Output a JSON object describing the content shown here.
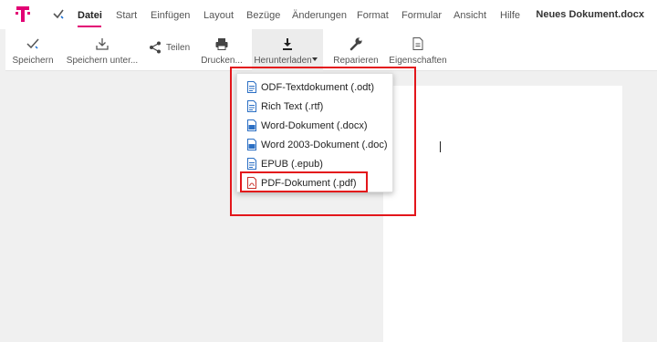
{
  "app": {
    "logo": "telekom-t-logo",
    "document_title": "Neues Dokument.docx",
    "brand_color": "#e20074"
  },
  "menu": {
    "check_icon": "check-icon",
    "items": [
      "Datei",
      "Start",
      "Einfügen",
      "Layout",
      "Bezüge",
      "Änderungen",
      "Format",
      "Formular",
      "Ansicht",
      "Hilfe"
    ],
    "active": "Datei"
  },
  "ribbon": {
    "save": "Speichern",
    "save_as": "Speichern unter...",
    "share": "Teilen",
    "print": "Drucken...",
    "download": "Herunterladen",
    "repair": "Reparieren",
    "properties": "Eigenschaften"
  },
  "download_menu": {
    "items": [
      "ODF-Textdokument (.odt)",
      "Rich Text (.rtf)",
      "Word-Dokument (.docx)",
      "Word 2003-Dokument (.doc)",
      "EPUB (.epub)",
      "PDF-Dokument (.pdf)"
    ],
    "highlighted": "PDF-Dokument (.pdf)"
  },
  "annotation": {
    "highlight_color": "#e3161b"
  }
}
